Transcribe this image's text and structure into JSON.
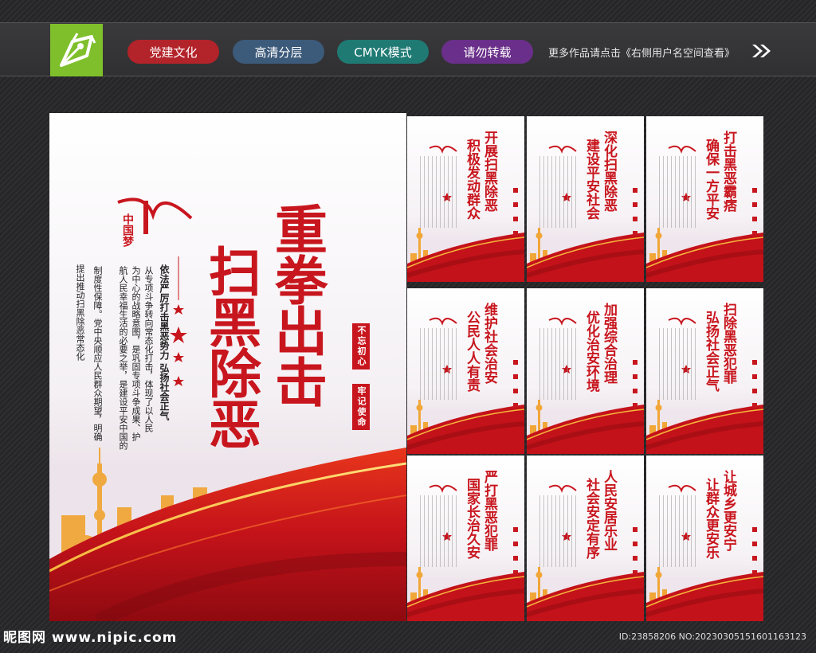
{
  "header": {
    "tags": [
      {
        "label": "党建文化",
        "color": "#b3232a"
      },
      {
        "label": "高清分层",
        "color": "#3c5a7a"
      },
      {
        "label": "CMYK模式",
        "color": "#1f7a74"
      },
      {
        "label": "请勿转载",
        "color": "#6a2f8a"
      }
    ],
    "more_text": "更多作品请点击《右侧用户名空间查看》"
  },
  "main_poster": {
    "title_col1": "重拳出击",
    "title_col2": "扫黑除恶",
    "logo_text": "中国梦",
    "heading": "依法严厉打击黑恶势力 弘扬社会正气",
    "body_lines": [
      "从专项斗争转向常态化打击，体现了以人民",
      "为中心的战略意图，是巩固专项斗争成果、护",
      "航人民幸福生活的必要之举，是建设平安中国的",
      "制度性保障。党中央顺应人民群众期望，明确",
      "提出推动扫黑除恶常态化"
    ],
    "seal_1": "不忘初心",
    "seal_2": "牢记使命"
  },
  "mini_posters": [
    {
      "line1": "开展扫黑除恶",
      "line2": "积极发动群众"
    },
    {
      "line1": "深化扫黑除恶",
      "line2": "建设平安社会"
    },
    {
      "line1": "打击黑恶霸痞",
      "line2": "确保一方平安"
    },
    {
      "line1": "维护社会治安",
      "line2": "公民人人有责"
    },
    {
      "line1": "加强综合治理",
      "line2": "优化治安环境"
    },
    {
      "line1": "扫除黑恶犯罪",
      "line2": "弘扬社会正气"
    },
    {
      "line1": "严打黑恶犯罪",
      "line2": "国家长治久安"
    },
    {
      "line1": "人民安居乐业",
      "line2": "社会安定有序"
    },
    {
      "line1": "让城乡更安宁",
      "line2": "让群众更安乐"
    }
  ],
  "footer": {
    "site": "昵图网 www.nipic.com",
    "id_text": "ID:23858206 NO:20230305151601163123"
  },
  "colors": {
    "accent_red": "#c8161e",
    "logo_green": "#7fbf2c"
  }
}
